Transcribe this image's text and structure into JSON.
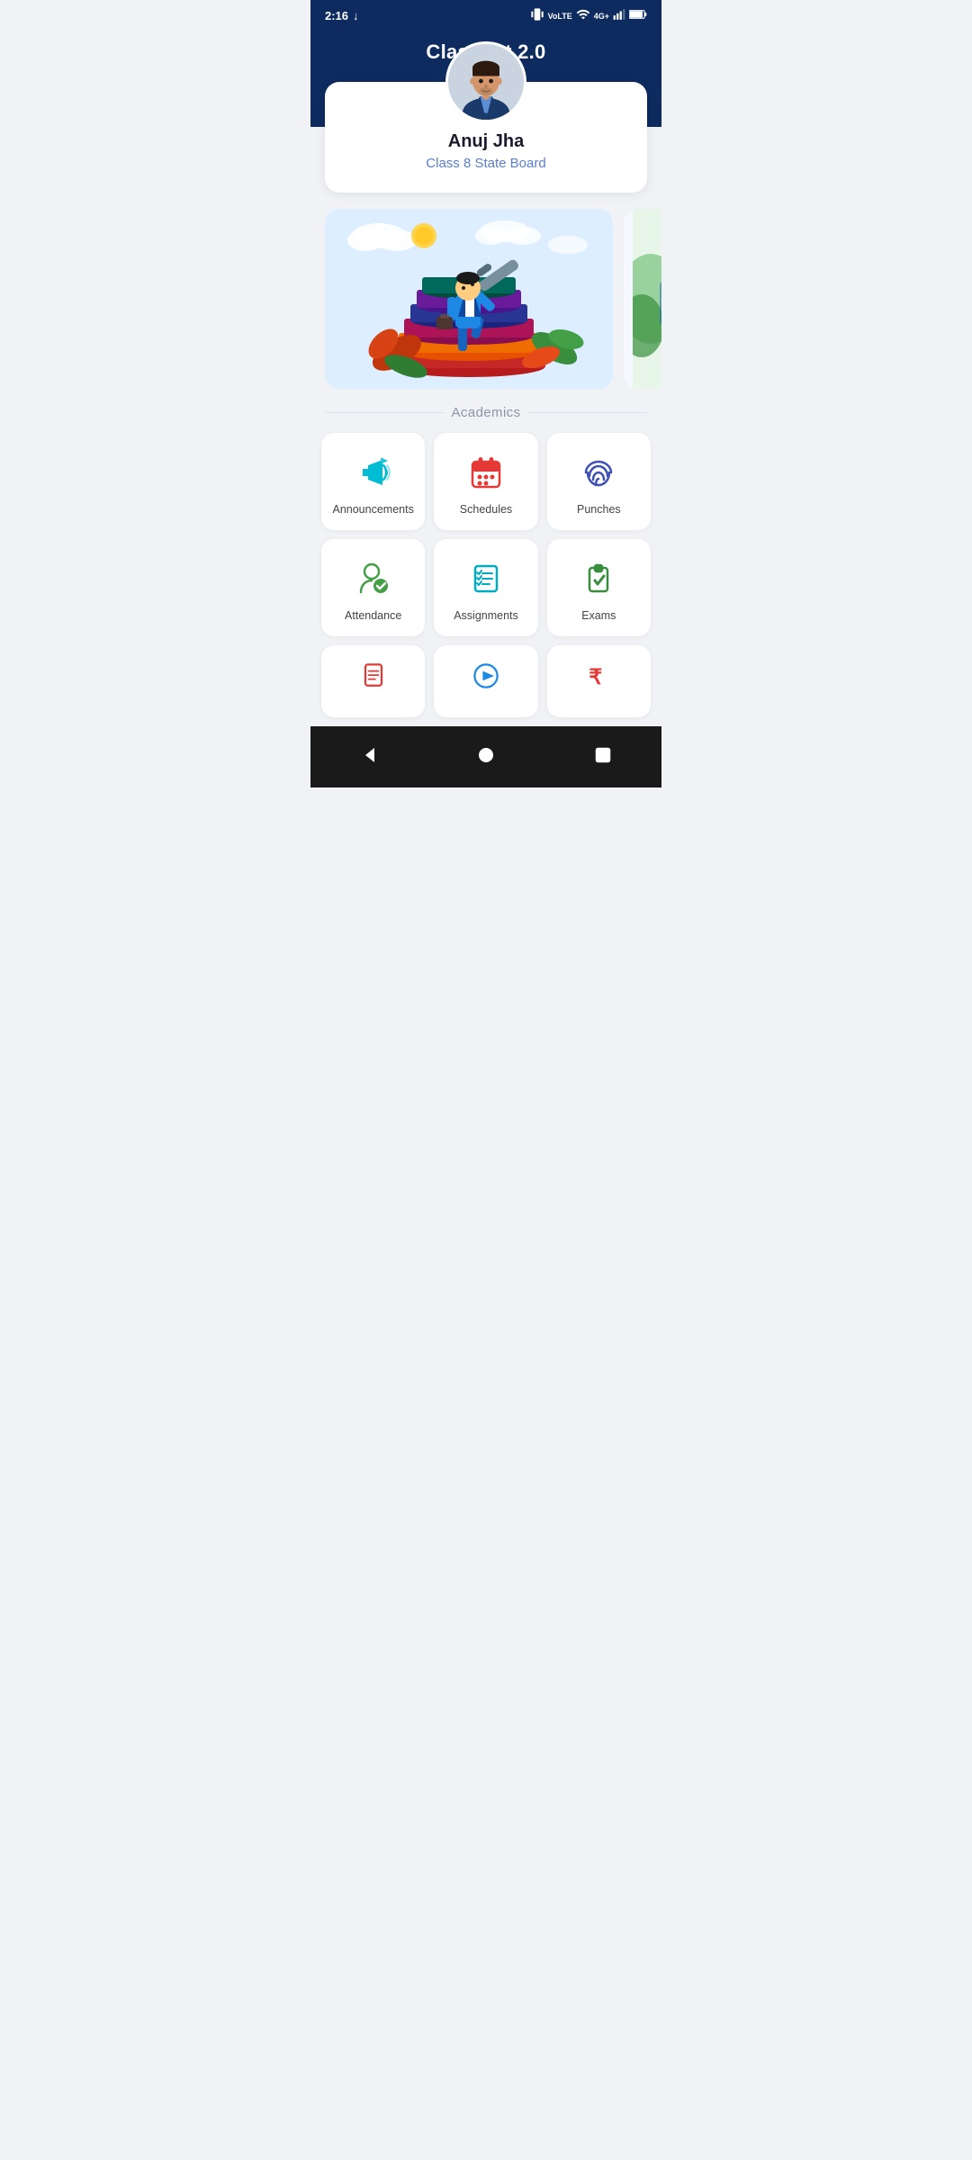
{
  "statusBar": {
    "time": "2:16",
    "downloadIcon": "↓",
    "vibrate": "📳",
    "volte": "VoLTE",
    "wifi": "wifi",
    "network": "4G+",
    "signal": "signal",
    "battery": "battery"
  },
  "header": {
    "title": "Classbot 2.0"
  },
  "profile": {
    "name": "Anuj Jha",
    "class": "Class 8 State Board"
  },
  "sections": {
    "academics": "Academics"
  },
  "gridItems": [
    {
      "id": "announcements",
      "label": "Announcements",
      "iconColor": "#00bcd4"
    },
    {
      "id": "schedules",
      "label": "Schedules",
      "iconColor": "#e53935"
    },
    {
      "id": "punches",
      "label": "Punches",
      "iconColor": "#3f51b5"
    },
    {
      "id": "attendance",
      "label": "Attendance",
      "iconColor": "#43a047"
    },
    {
      "id": "assignments",
      "label": "Assignments",
      "iconColor": "#00acc1"
    },
    {
      "id": "exams",
      "label": "Exams",
      "iconColor": "#388e3c"
    }
  ],
  "partialItems": [
    {
      "id": "notes",
      "iconColor": "#e53935"
    },
    {
      "id": "play",
      "iconColor": "#1e88e5"
    },
    {
      "id": "fees",
      "iconColor": "#e53935"
    }
  ],
  "bottomNav": {
    "backLabel": "◀",
    "homeLabel": "●",
    "recentLabel": "■"
  }
}
